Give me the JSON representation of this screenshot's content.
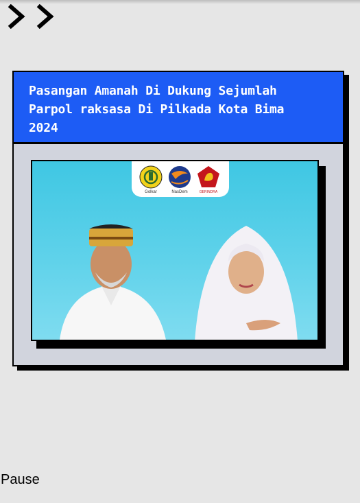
{
  "nav": {
    "icon": "double-chevron-right-icon"
  },
  "card": {
    "title": "Pasangan Amanah Di Dukung Sejumlah\nParpol raksasa Di Pilkada Kota Bima\n2024"
  },
  "photo": {
    "parties": [
      {
        "name": "Golkar",
        "color": "#f2d21b",
        "icon": "golkar-logo-icon"
      },
      {
        "name": "NasDem",
        "color": "#1d3a8c",
        "icon": "nasdem-logo-icon"
      },
      {
        "name": "GERINDRA",
        "color": "#c4161c",
        "icon": "gerindra-logo-icon"
      }
    ]
  },
  "controls": {
    "pause_label": "Pause"
  },
  "colors": {
    "header_bg": "#1d5cf5",
    "card_bg": "#d1d4dd",
    "photo_bg": "#4fcde6",
    "page_bg": "#e6e6e6"
  }
}
